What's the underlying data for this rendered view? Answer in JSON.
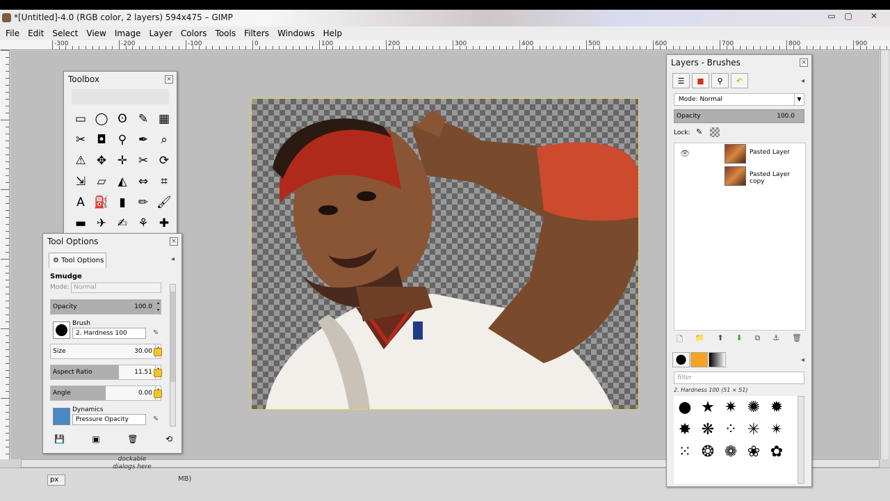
{
  "window": {
    "title": "*[Untitled]-4.0 (RGB color, 2 layers) 594x475 – GIMP",
    "minimize": "▭",
    "maximize": "▢",
    "close": "✕"
  },
  "menu": [
    "File",
    "Edit",
    "Select",
    "View",
    "Image",
    "Layer",
    "Colors",
    "Tools",
    "Filters",
    "Windows",
    "Help"
  ],
  "ruler": {
    "labels": [
      "-300",
      "-200",
      "-100",
      "0",
      "100",
      "200",
      "300",
      "400",
      "500",
      "600",
      "700",
      "800",
      "900"
    ]
  },
  "toolbox": {
    "title": "Toolbox",
    "close": "×",
    "tools": [
      {
        "icon": "rect-select-icon",
        "glyph": "▭"
      },
      {
        "icon": "ellipse-select-icon",
        "glyph": "◯"
      },
      {
        "icon": "free-select-icon",
        "glyph": "ʘ"
      },
      {
        "icon": "fuzzy-select-icon",
        "glyph": "✎"
      },
      {
        "icon": "select-by-color-icon",
        "glyph": "▦"
      },
      {
        "icon": "scissors-select-icon",
        "glyph": "✂"
      },
      {
        "icon": "foreground-select-icon",
        "glyph": "◘"
      },
      {
        "icon": "paths-icon",
        "glyph": "⚲"
      },
      {
        "icon": "color-picker-icon",
        "glyph": "✒"
      },
      {
        "icon": "zoom-icon",
        "glyph": "⌕"
      },
      {
        "icon": "measure-icon",
        "glyph": "⚠"
      },
      {
        "icon": "move-icon",
        "glyph": "✥"
      },
      {
        "icon": "align-icon",
        "glyph": "✛"
      },
      {
        "icon": "crop-icon",
        "glyph": "✂"
      },
      {
        "icon": "rotate-icon",
        "glyph": "⟳"
      },
      {
        "icon": "scale-icon",
        "glyph": "⇲"
      },
      {
        "icon": "shear-icon",
        "glyph": "▱"
      },
      {
        "icon": "perspective-icon",
        "glyph": "◭"
      },
      {
        "icon": "flip-icon",
        "glyph": "⇔"
      },
      {
        "icon": "cage-icon",
        "glyph": "⌗"
      },
      {
        "icon": "text-icon",
        "glyph": "A"
      },
      {
        "icon": "bucket-fill-icon",
        "glyph": "⛽"
      },
      {
        "icon": "blend-icon",
        "glyph": "▮"
      },
      {
        "icon": "pencil-icon",
        "glyph": "✏"
      },
      {
        "icon": "paintbrush-icon",
        "glyph": "🖌"
      },
      {
        "icon": "eraser-icon",
        "glyph": "▬"
      },
      {
        "icon": "airbrush-icon",
        "glyph": "✈"
      },
      {
        "icon": "ink-icon",
        "glyph": "✍"
      },
      {
        "icon": "clone-icon",
        "glyph": "⚘"
      },
      {
        "icon": "heal-icon",
        "glyph": "✚"
      }
    ]
  },
  "tool_options": {
    "title": "Tool Options",
    "close": "×",
    "tab_label": "Tool Options",
    "tool_name": "Smudge",
    "mode_label": "Mode:",
    "mode_value": "Normal",
    "opacity_label": "Opacity",
    "opacity_value": "100.0",
    "opacity": 1.0,
    "brush_label": "Brush",
    "brush_value": "2. Hardness 100",
    "size_label": "Size",
    "size_value": "30.00",
    "aspect_label": "Aspect Ratio",
    "aspect_value": "11.51",
    "aspect_level": 0.62,
    "angle_label": "Angle",
    "angle_value": "0.00",
    "angle_level": 0.5,
    "dynamics_label": "Dynamics",
    "dynamics_value": "Pressure Opacity",
    "dockable_text": "dockable dialogs here"
  },
  "status": {
    "unit": "px",
    "text": "MB)"
  },
  "layers_panel": {
    "title": "Layers - Brushes",
    "close": "×",
    "mode_label": "Mode:",
    "mode_value": "Normal",
    "opacity_label": "Opacity",
    "opacity_value": "100.0",
    "lock_label": "Lock:",
    "layers": [
      {
        "name": "Pasted Layer",
        "visible": true
      },
      {
        "name": "Pasted Layer copy",
        "visible": false
      }
    ],
    "brush_filter_placeholder": "filter",
    "brush_info": "2. Hardness 100 (51 × 51)"
  },
  "colors": {
    "accent": "#f1c232",
    "canvas_bg": "#bebebe",
    "panel_bg": "#efefef"
  }
}
